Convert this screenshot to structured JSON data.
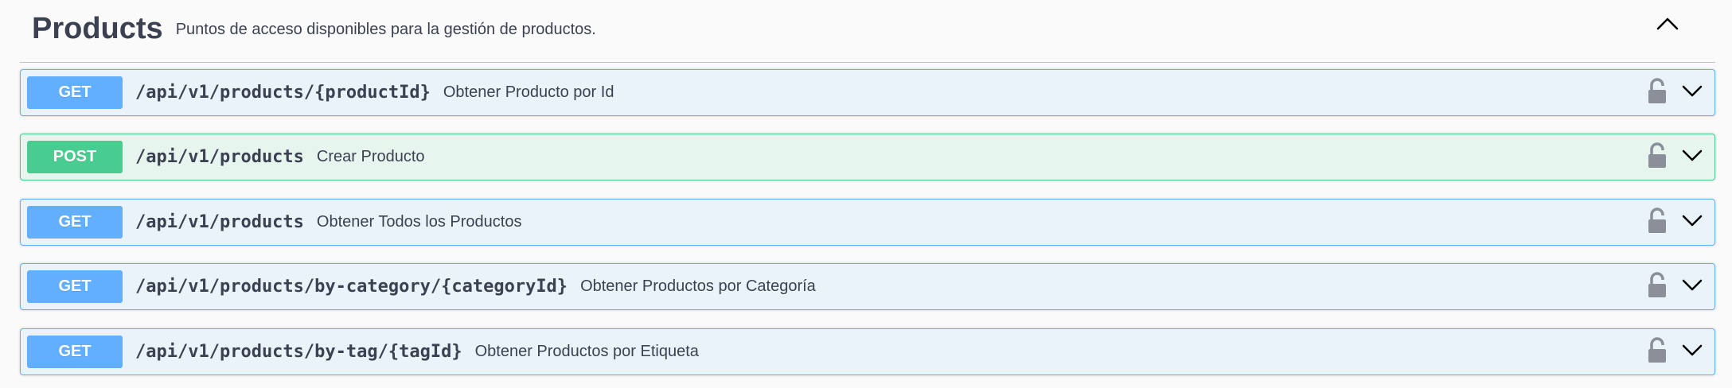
{
  "tag": {
    "title": "Products",
    "description": "Puntos de acceso disponibles para la gestión de productos."
  },
  "operations": [
    {
      "method": "GET",
      "path": "/api/v1/products/{productId}",
      "summary": "Obtener Producto por Id"
    },
    {
      "method": "POST",
      "path": "/api/v1/products",
      "summary": "Crear Producto"
    },
    {
      "method": "GET",
      "path": "/api/v1/products",
      "summary": "Obtener Todos los Productos"
    },
    {
      "method": "GET",
      "path": "/api/v1/products/by-category/{categoryId}",
      "summary": "Obtener Productos por Categoría"
    },
    {
      "method": "GET",
      "path": "/api/v1/products/by-tag/{tagId}",
      "summary": "Obtener Productos por Etiqueta"
    }
  ],
  "icons": {
    "collapse": "chevron-up-icon",
    "lock": "unlocked-padlock-icon",
    "expand": "chevron-down-icon"
  },
  "colors": {
    "get": "#61affe",
    "post": "#49cc90",
    "text": "#3b4151"
  }
}
